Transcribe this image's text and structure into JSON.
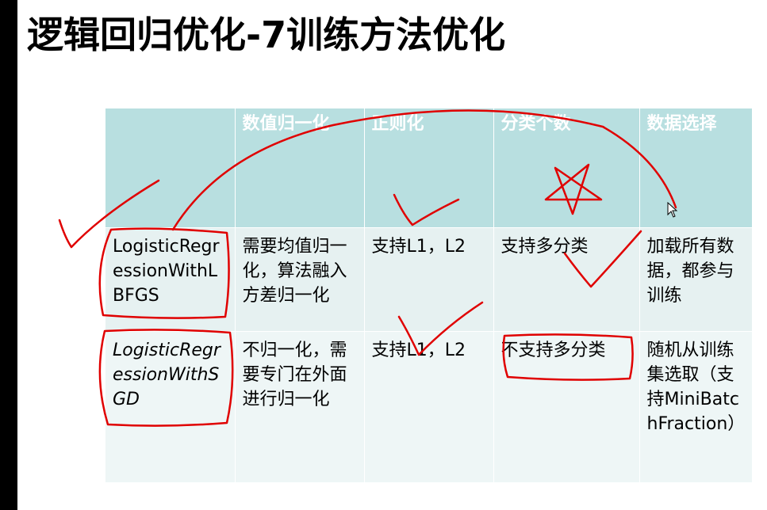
{
  "slide": {
    "title": "逻辑回归优化-7训练方法优化"
  },
  "table": {
    "headers": [
      "",
      "数值归一化",
      "正则化",
      "分类个数",
      "数据选择"
    ],
    "rows": [
      {
        "method": "LogisticRegressionWithLBFGS",
        "normalization": "需要均值归一化，算法融入方差归一化",
        "regularization": "支持L1，L2",
        "num_classes": "支持多分类",
        "data_selection": "加载所有数据，都参与训练"
      },
      {
        "method": "LogisticRegressionWithSGD",
        "normalization": "不归一化，需要专门在外面进行归一化",
        "regularization": "支持L1，L2",
        "num_classes": "不支持多分类",
        "data_selection": "随机从训练集选取（支持MiniBatchFraction）"
      }
    ]
  },
  "colors": {
    "header_bg": "#b8dfe0",
    "row1_bg": "#e6f1f1",
    "row2_bg": "#eef6f6",
    "annotation_red": "#e00000",
    "left_bar": "#000000"
  },
  "icons": {
    "cursor": "mouse-pointer-icon"
  }
}
